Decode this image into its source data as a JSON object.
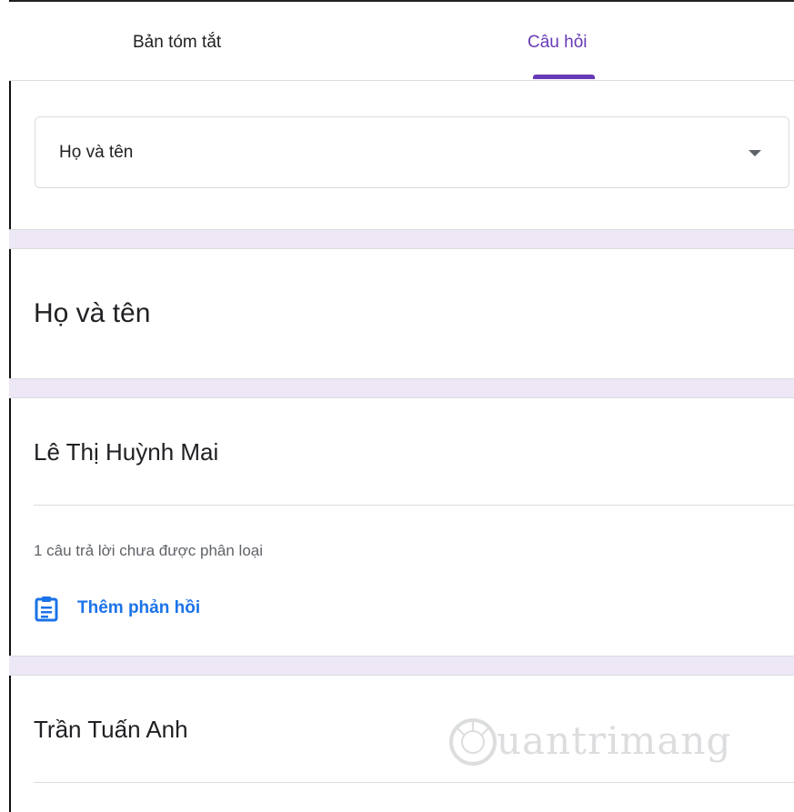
{
  "tabs": [
    {
      "label": "Bản tóm tắt",
      "active": false
    },
    {
      "label": "Câu hỏi",
      "active": true
    }
  ],
  "dropdown": {
    "selected": "Họ và tên"
  },
  "question": {
    "title": "Họ và tên"
  },
  "answers": [
    {
      "text": "Lê Thị Huỳnh Mai"
    },
    {
      "text": "Trần Tuấn Anh"
    }
  ],
  "grading": {
    "ungraded_text": "1 câu trả lời chưa được phân loại",
    "add_feedback_label": "Thêm phản hồi",
    "add_feedback_icon": "clipboard-feedback-icon"
  },
  "watermark": {
    "text": "uantrimang"
  },
  "colors": {
    "accent": "#673ab7",
    "link": "#1a73e8",
    "separator": "#ede7f6"
  }
}
